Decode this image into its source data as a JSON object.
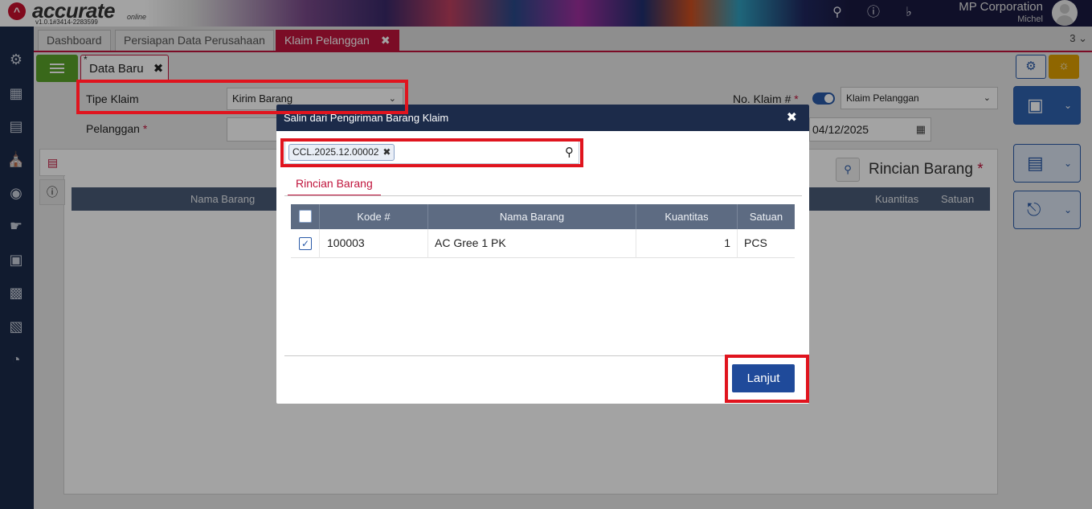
{
  "app": {
    "logo_text": "accurate",
    "logo_sub": "online",
    "version": "v1.0.1#3414-2283599",
    "company": "MP Corporation",
    "user": "Michel"
  },
  "tabs": [
    {
      "label": "Dashboard"
    },
    {
      "label": "Persiapan Data Perusahaan"
    },
    {
      "label": "Klaim Pelanggan",
      "active": true
    }
  ],
  "tab_count": "3",
  "subtab": {
    "label": "Data Baru",
    "dirty_marker": "*"
  },
  "form": {
    "tipe_klaim_label": "Tipe Klaim",
    "tipe_klaim_value": "Kirim Barang",
    "pelanggan_label": "Pelanggan",
    "no_klaim_label": "No. Klaim #",
    "no_klaim_value": "Klaim Pelanggan",
    "date_value": "04/12/2025",
    "required_mark": "*"
  },
  "detail_panel": {
    "title": "Rincian Barang",
    "columns": [
      "Nama Barang",
      "Kuantitas",
      "Satuan"
    ]
  },
  "modal": {
    "title": "Salin dari Pengiriman Barang Klaim",
    "chip": "CCL.2025.12.00002",
    "tab_label": "Rincian Barang",
    "columns": [
      "Kode #",
      "Nama Barang",
      "Kuantitas",
      "Satuan"
    ],
    "rows": [
      {
        "checked": true,
        "kode": "100003",
        "nama": "AC Gree 1 PK",
        "qty": "1",
        "satuan": "PCS"
      }
    ],
    "button_label": "Lanjut"
  },
  "colors": {
    "accent_red": "#c0143c",
    "nav_bg": "#1c2b4a",
    "primary_blue": "#1f4a9a",
    "annotation_red": "#e0141e"
  }
}
